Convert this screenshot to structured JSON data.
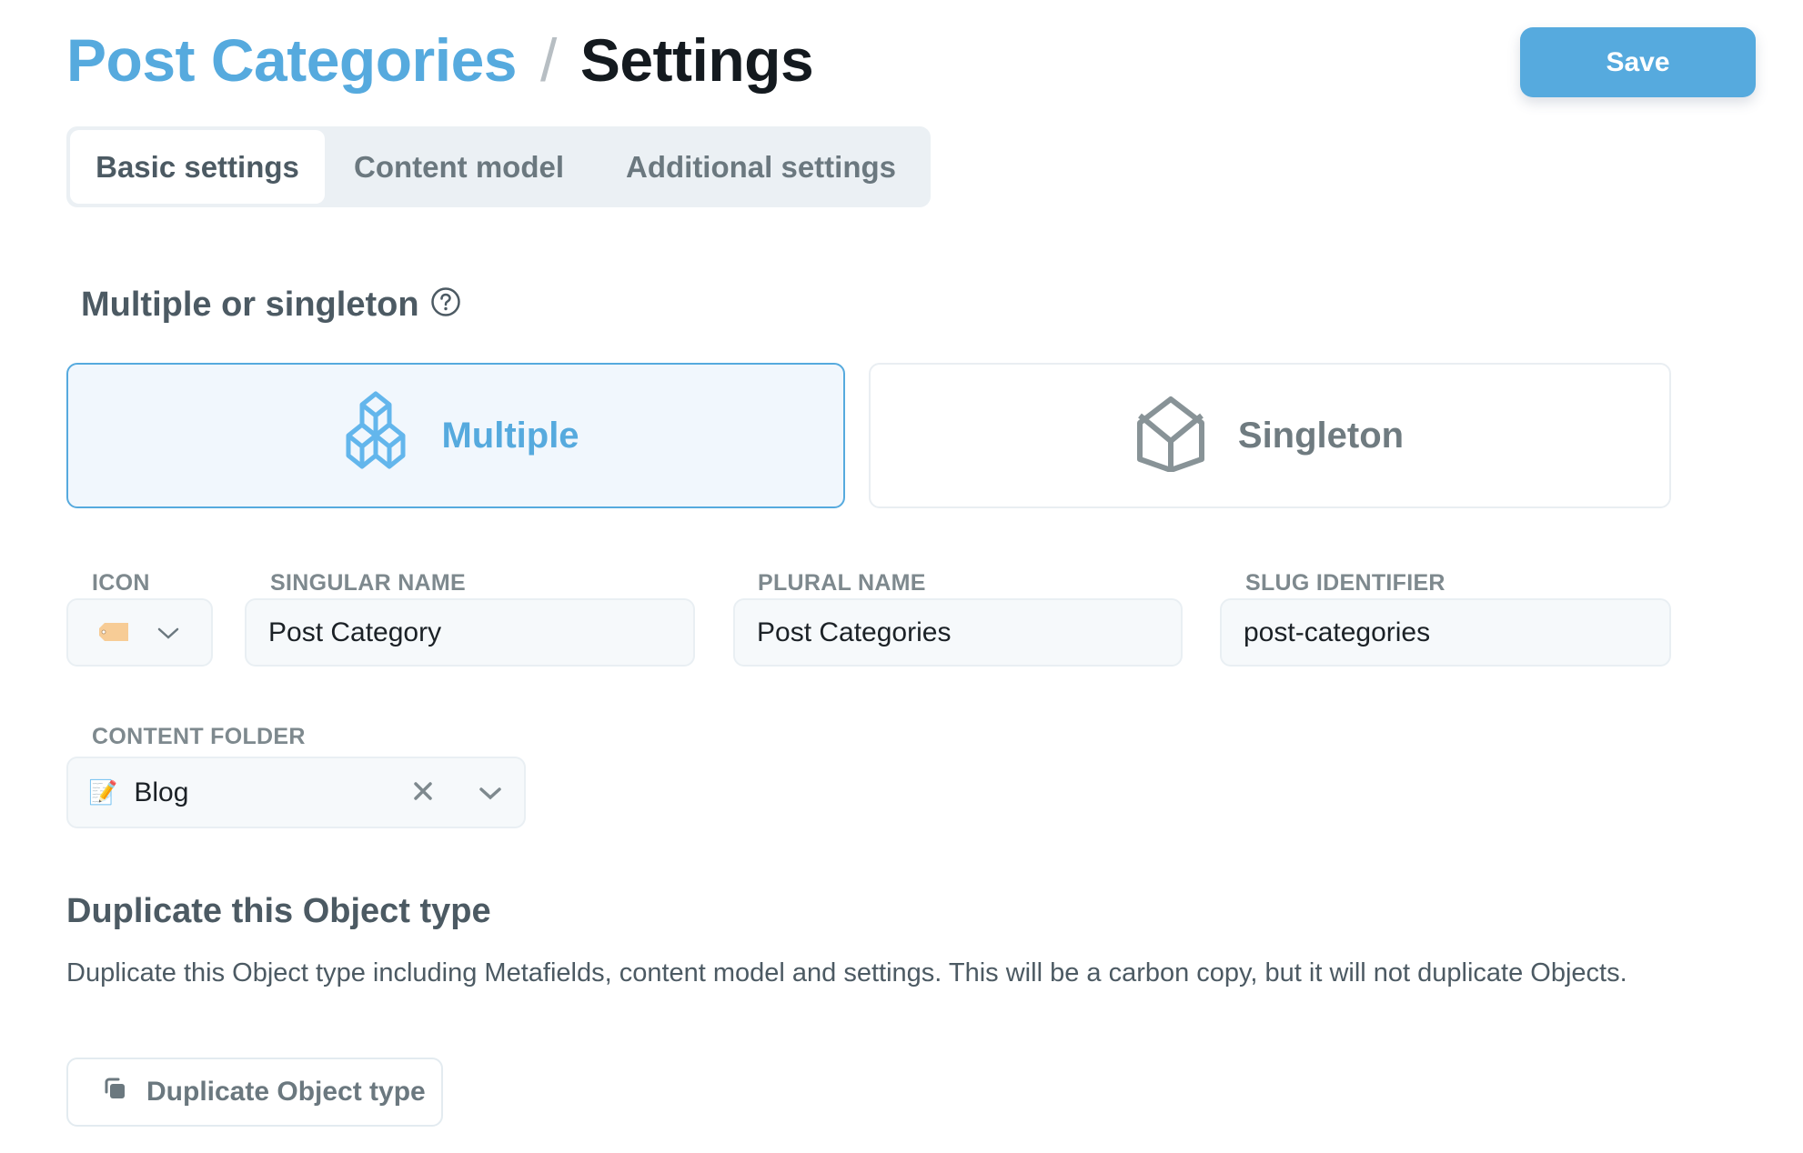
{
  "header": {
    "breadcrumb_parent": "Post Categories",
    "separator": "/",
    "current_page": "Settings",
    "save_label": "Save"
  },
  "tabs": [
    {
      "label": "Basic settings",
      "active": true
    },
    {
      "label": "Content model",
      "active": false
    },
    {
      "label": "Additional settings",
      "active": false
    }
  ],
  "mode_section": {
    "heading": "Multiple or singleton",
    "help_icon": "question-circle-icon",
    "options": [
      {
        "label": "Multiple",
        "icon": "cubes-icon",
        "selected": true
      },
      {
        "label": "Singleton",
        "icon": "cube-icon",
        "selected": false
      }
    ]
  },
  "fields": {
    "icon": {
      "label": "ICON",
      "value": "🏷️"
    },
    "singular_name": {
      "label": "SINGULAR NAME",
      "value": "Post Category"
    },
    "plural_name": {
      "label": "PLURAL NAME",
      "value": "Post Categories"
    },
    "slug": {
      "label": "SLUG IDENTIFIER",
      "value": "post-categories"
    },
    "content_folder": {
      "label": "CONTENT FOLDER",
      "emoji": "📝",
      "value": "Blog"
    }
  },
  "duplicate": {
    "heading": "Duplicate this Object type",
    "description": "Duplicate this Object type including Metafields, content model and settings. This will be a carbon copy, but it will not duplicate Objects.",
    "button_label": "Duplicate Object type"
  },
  "colors": {
    "accent": "#56aade",
    "text_primary": "#4c5a63",
    "heading_dark": "#141a1f",
    "muted": "#7e898e"
  }
}
